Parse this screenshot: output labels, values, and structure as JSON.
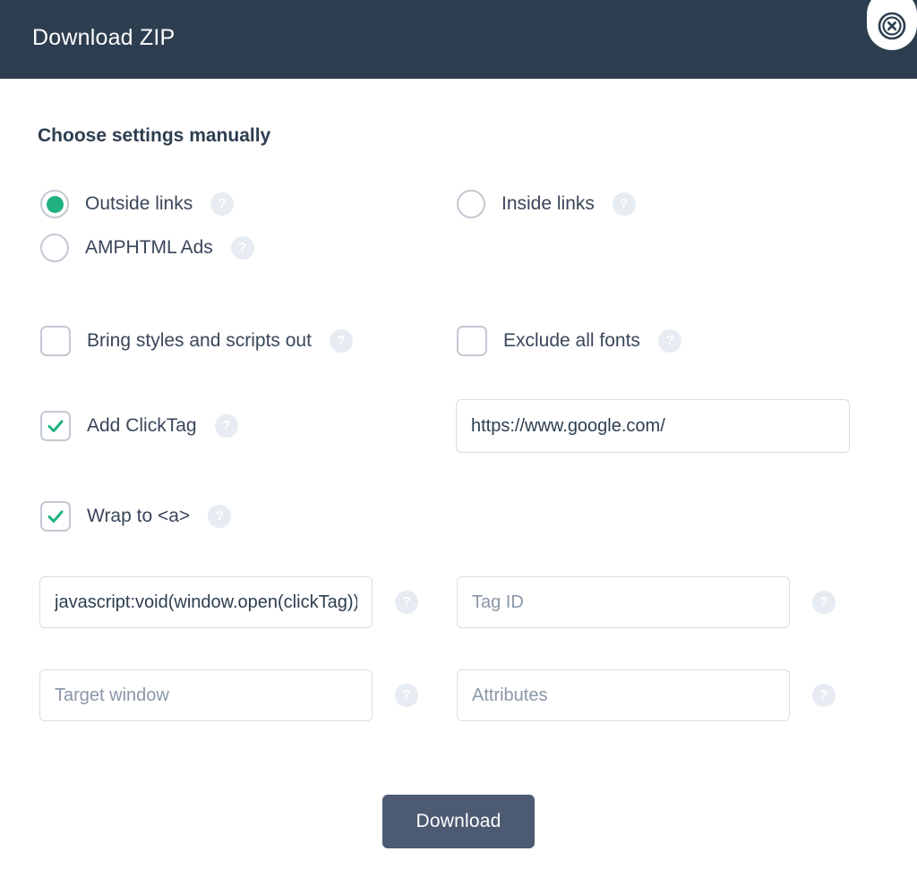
{
  "header": {
    "title": "Download ZIP",
    "close_icon": "close-circle-icon",
    "background_color": "#2d3e50"
  },
  "body": {
    "section_title": "Choose settings manually",
    "help_glyph": "?",
    "accent_color": "#21b183",
    "link_type": {
      "outside": {
        "label": "Outside links",
        "checked": true
      },
      "inside": {
        "label": "Inside links",
        "checked": false
      },
      "amphtml": {
        "label": "AMPHTML Ads",
        "checked": false
      }
    },
    "options": {
      "bring_styles": {
        "label": "Bring styles and scripts out",
        "checked": false
      },
      "exclude_fonts": {
        "label": "Exclude all fonts",
        "checked": false
      },
      "add_clicktag": {
        "label": "Add ClickTag",
        "checked": true
      },
      "wrap_to_a": {
        "label": "Wrap to <a>",
        "checked": true
      }
    },
    "fields": {
      "clicktag_url": {
        "value": "https://www.google.com/",
        "placeholder": ""
      },
      "javascript_href": {
        "value": "javascript:void(window.open(clickTag))",
        "placeholder": ""
      },
      "tag_id": {
        "value": "",
        "placeholder": "Tag ID"
      },
      "target_window": {
        "value": "",
        "placeholder": "Target window"
      },
      "attributes": {
        "value": "",
        "placeholder": "Attributes"
      }
    }
  },
  "footer": {
    "download_label": "Download",
    "download_color": "#4c5a72"
  }
}
